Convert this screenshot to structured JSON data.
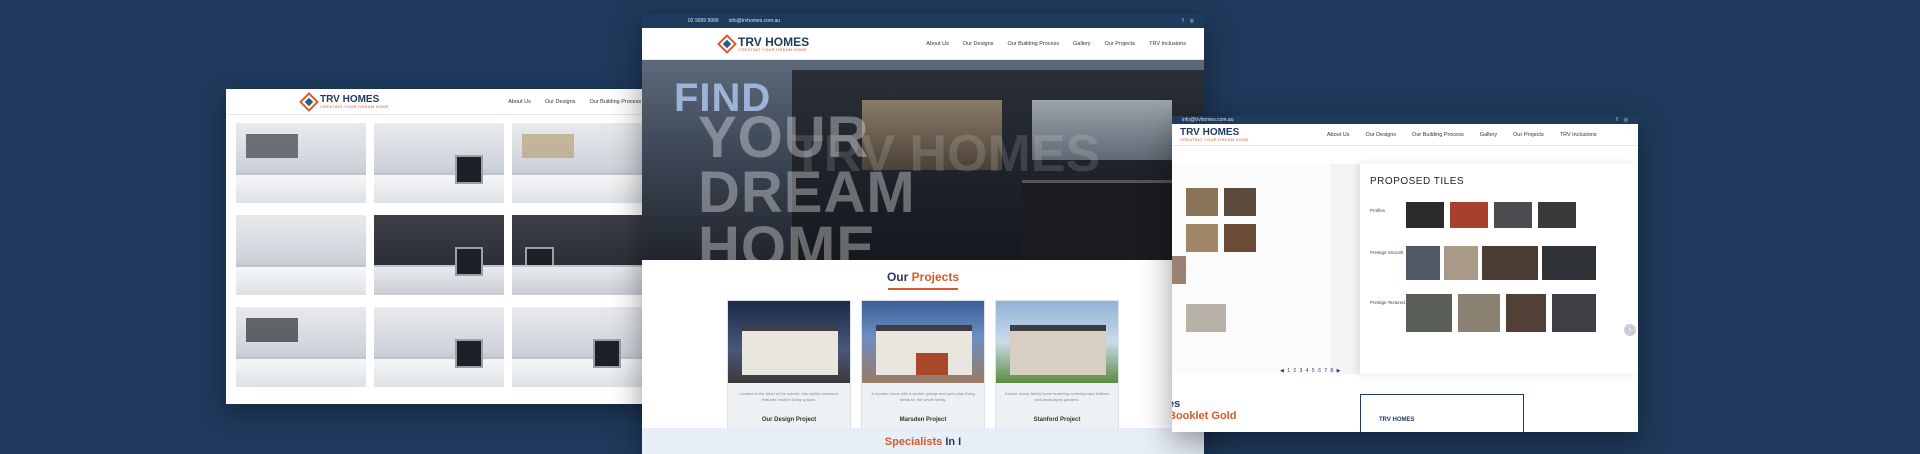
{
  "brand": {
    "name": "TRV HOMES",
    "tagline": "CREATING YOUR DREAM HOME"
  },
  "colors": {
    "navy": "#1f3a5c",
    "orange": "#d8592a",
    "background": "#1f3a5c"
  },
  "topbar": {
    "phone": "02 9099 9999",
    "email": "info@trvhomes.com.au",
    "social": [
      "facebook-icon",
      "instagram-icon"
    ]
  },
  "menu": [
    "About Us",
    "Our Designs",
    "Our Building Process",
    "Gallery",
    "Our Projects",
    "TRV Inclusions"
  ],
  "window_center": {
    "hero_find": "FIND",
    "hero_lines": [
      "YOUR",
      "DREAM",
      "HOME"
    ],
    "hero_ghost": "TRV HOMES",
    "projects_heading_1": "Our",
    "projects_heading_2": "Projects",
    "cards": [
      {
        "text": "Located in the heart of the suburb, this stylish residence features modern living spaces.",
        "name": "Our Design Project"
      },
      {
        "text": "A modern home with a double garage and open plan living areas for the whole family.",
        "name": "Marsden Project"
      },
      {
        "text": "Double storey family home featuring contemporary finishes and landscaped gardens.",
        "name": "Stanford Project"
      }
    ],
    "dots": "● ● ● ● ●",
    "specialists_1": "Specialists",
    "specialists_2": "In I"
  },
  "window_right": {
    "tiles_title": "PROPOSED TILES",
    "labels": [
      "Profiles",
      "Prestige Smooth",
      "Prestige Textured"
    ],
    "pager": "◀ 1 2 3 4 5 6 7 8 ▶",
    "bottom_title": "es",
    "booklet": "Booklet Gold",
    "booklet_logo": "TRV HOMES"
  }
}
